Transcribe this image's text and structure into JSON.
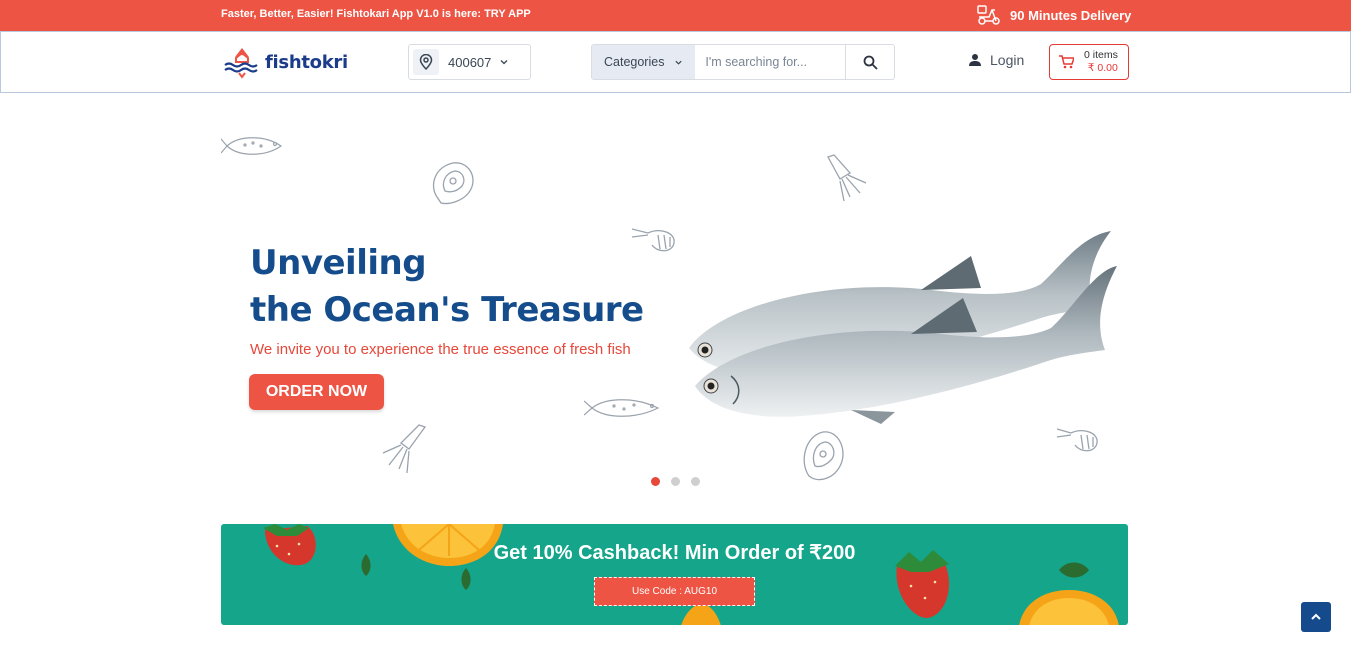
{
  "topbar": {
    "promo_text": "Faster, Better, Easier! Fishtokari App V1.0 is here: TRY APP",
    "delivery_text": "90 Minutes Delivery"
  },
  "header": {
    "logo_text": "fishtokri",
    "pincode": "400607",
    "search": {
      "category_label": "Categories",
      "placeholder": "I'm searching for..."
    },
    "login_label": "Login",
    "cart": {
      "items": "0 items",
      "price": "₹ 0.00"
    }
  },
  "hero": {
    "title_line1": "Unveiling",
    "title_line2": "the Ocean's Treasure",
    "subtitle": "We invite you to experience the true essence of fresh fish",
    "cta_label": "ORDER NOW",
    "slides_total": 3,
    "active_slide": 1
  },
  "cashback": {
    "title": "Get 10% Cashback! Min Order of ₹200",
    "coupon_label": "Use Code : AUG10"
  },
  "colors": {
    "brand_red": "#ee5444",
    "brand_navy": "#144c8c",
    "banner_green": "#14a58a"
  },
  "icons": [
    "scooter-icon",
    "location-pin-icon",
    "chevron-down-icon",
    "search-icon",
    "user-icon",
    "cart-icon",
    "chevron-up-icon"
  ]
}
